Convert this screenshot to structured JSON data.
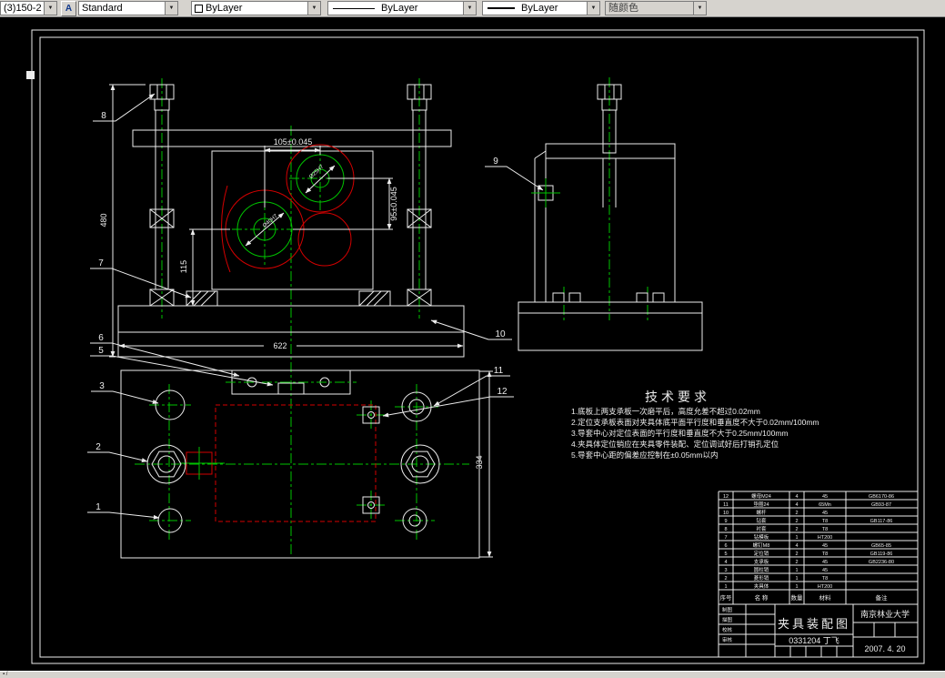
{
  "toolbar": {
    "layer": "(3)150-2",
    "style_icon": "A",
    "style": "Standard",
    "color": "ByLayer",
    "linetype": "ByLayer",
    "lineweight": "ByLayer",
    "plotstyle": "随颜色"
  },
  "statusbar": {
    "left": "▪ /"
  },
  "dims": {
    "d105": "105±0.045",
    "d95": "95±0.045",
    "d480": "480",
    "d115": "115",
    "d622": "622",
    "d334": "334",
    "bore1": "Ø40H7",
    "bore2": "Ø25H7"
  },
  "callouts": {
    "n1": "1",
    "n2": "2",
    "n3": "3",
    "n5": "5",
    "n6": "6",
    "n7": "7",
    "n8": "8",
    "n9": "9",
    "n10": "10",
    "n11": "11",
    "n12": "12"
  },
  "tech": {
    "title": "技术要求",
    "lines": [
      "1.底板上两支承板一次磨平后，高度允差不超过0.02mm",
      "2.定位支承板表面对夹具体底平面平行度和垂直度不大于0.02mm/100mm",
      "3.导套中心对定位表面的平行度和垂直度不大于0.25mm/100mm",
      "4.夹具体定位销应在夹具零件装配、定位调试好后打销孔定位",
      "5.导套中心距的偏差应控制在±0.05mm以内"
    ]
  },
  "titleblock": {
    "name": "夹具装配图",
    "number": "0331204  丁飞",
    "org": "南京林业大学",
    "date": "2007. 4. 20",
    "signs": [
      "制图",
      "描图",
      "校核",
      "审核"
    ],
    "bom": {
      "header": [
        "序号",
        "名 称",
        "数量",
        "材料",
        "备注"
      ],
      "rows": [
        [
          "12",
          "螺母M24",
          "4",
          "45",
          "GB6170-86"
        ],
        [
          "11",
          "垫圈24",
          "4",
          "65Mn",
          "GB93-87"
        ],
        [
          "10",
          "螺杆",
          "2",
          "45",
          ""
        ],
        [
          "9",
          "钻套",
          "2",
          "T8",
          "GB117-86"
        ],
        [
          "8",
          "衬套",
          "2",
          "T8",
          ""
        ],
        [
          "7",
          "钻模板",
          "1",
          "HT200",
          ""
        ],
        [
          "6",
          "螺钉M8",
          "4",
          "45",
          "GB65-85"
        ],
        [
          "5",
          "定位销",
          "2",
          "T8",
          "GB119-86"
        ],
        [
          "4",
          "支承板",
          "2",
          "45",
          "GB2236-80"
        ],
        [
          "3",
          "圆柱销",
          "1",
          "45",
          ""
        ],
        [
          "2",
          "菱形销",
          "1",
          "T8",
          ""
        ],
        [
          "1",
          "夹具体",
          "1",
          "HT200",
          ""
        ]
      ]
    }
  }
}
